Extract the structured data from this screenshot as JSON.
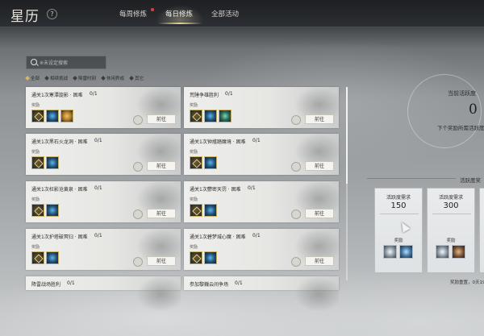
{
  "header": {
    "title": "星历",
    "help": "?",
    "tabs": [
      {
        "label": "每周修炼",
        "active": false,
        "badge": true
      },
      {
        "label": "每日修炼",
        "active": true,
        "badge": false
      },
      {
        "label": "全部活动",
        "active": false,
        "badge": false
      }
    ]
  },
  "search": {
    "placeholder": "※未设定搜索"
  },
  "filters": [
    {
      "label": "全部",
      "selected": true
    },
    {
      "label": "相续挑战",
      "selected": false
    },
    {
      "label": "降雷时刻",
      "selected": false
    },
    {
      "label": "休闲养成",
      "selected": false
    },
    {
      "label": "其它",
      "selected": false
    }
  ],
  "goto_label": "前往",
  "reward_label": "奖励",
  "cards": [
    {
      "title": "通关1次寒潭旋影 · 困难",
      "progress": "0/1",
      "items": [
        "gold",
        "blue",
        "gem"
      ]
    },
    {
      "title": "荒陲争雄胜利",
      "progress": "0/1",
      "items": [
        "gold",
        "blue",
        "jade"
      ]
    },
    {
      "title": "通关1次黑石火龙洞 · 困难",
      "progress": "0/1",
      "items": [
        "gold",
        "blue"
      ]
    },
    {
      "title": "通关1次钟馗踏魔境 · 困难",
      "progress": "0/1",
      "items": [
        "gold",
        "blue"
      ]
    },
    {
      "title": "通关1次枉影沧黄泉 · 困难",
      "progress": "0/1",
      "items": [
        "gold",
        "blue"
      ]
    },
    {
      "title": "通关1次鬱密天罚 · 困难",
      "progress": "0/1",
      "items": [
        "gold",
        "blue"
      ]
    },
    {
      "title": "通关1次护塔破冥归 · 困难",
      "progress": "0/1",
      "items": [
        "gold",
        "blue"
      ]
    },
    {
      "title": "通关1次碧梦城心魔 · 困难",
      "progress": "0/1",
      "items": [
        "gold",
        "blue"
      ]
    },
    {
      "title": "降雷战场胜利",
      "progress": "0/1",
      "items": []
    },
    {
      "title": "参加黎巍云间争场",
      "progress": "0/1",
      "items": []
    }
  ],
  "right_panel": {
    "current_label": "当前活跃度",
    "current_value": "0",
    "next_label": "下个奖励所需活跃度",
    "section_title": "活跃度奖",
    "boxes": [
      {
        "label": "活跃度需求",
        "value": "150",
        "reward": "奖励"
      },
      {
        "label": "活跃度需求",
        "value": "300",
        "reward": "奖励"
      }
    ],
    "reset_text": "奖励重置，0天19"
  }
}
